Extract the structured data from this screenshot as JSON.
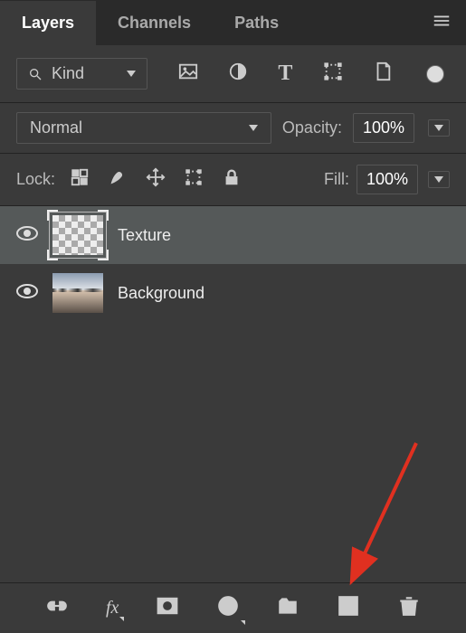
{
  "tabs": {
    "layers": "Layers",
    "channels": "Channels",
    "paths": "Paths"
  },
  "filter": {
    "kind_label": "Kind"
  },
  "blend": {
    "mode": "Normal",
    "opacity_label": "Opacity:",
    "opacity_value": "100%"
  },
  "lock": {
    "label": "Lock:",
    "fill_label": "Fill:",
    "fill_value": "100%"
  },
  "layers": [
    {
      "name": "Texture",
      "selected": true
    },
    {
      "name": "Background",
      "selected": false
    }
  ]
}
